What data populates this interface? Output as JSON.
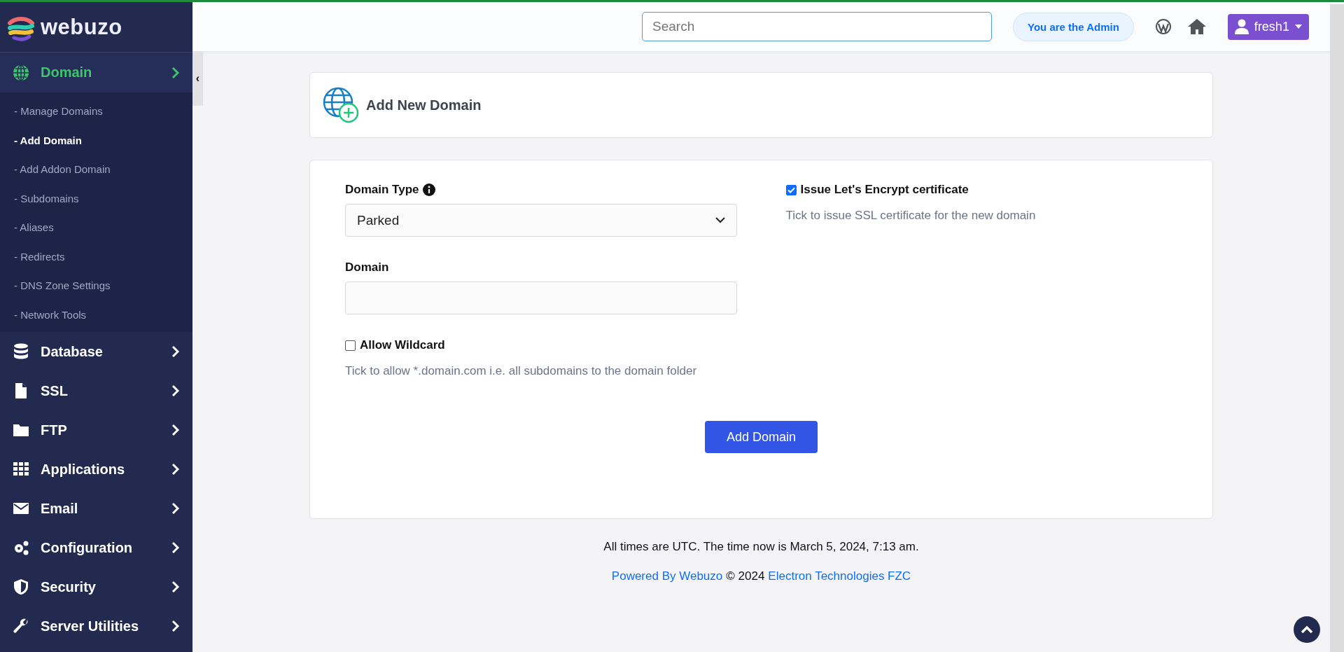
{
  "sidebar": {
    "logo": "webuzo",
    "menu": [
      {
        "label": "Domain",
        "expanded": true,
        "children": [
          {
            "label": "- Manage Domains",
            "selected": false
          },
          {
            "label": "- Add Domain",
            "selected": true
          },
          {
            "label": "- Add Addon Domain",
            "selected": false
          },
          {
            "label": "- Subdomains",
            "selected": false
          },
          {
            "label": "- Aliases",
            "selected": false
          },
          {
            "label": "- Redirects",
            "selected": false
          },
          {
            "label": "- DNS Zone Settings",
            "selected": false
          },
          {
            "label": "- Network Tools",
            "selected": false
          }
        ]
      },
      {
        "label": "Database",
        "expanded": false
      },
      {
        "label": "SSL",
        "expanded": false
      },
      {
        "label": "FTP",
        "expanded": false
      },
      {
        "label": "Applications",
        "expanded": false
      },
      {
        "label": "Email",
        "expanded": false
      },
      {
        "label": "Configuration",
        "expanded": false
      },
      {
        "label": "Security",
        "expanded": false
      },
      {
        "label": "Server Utilities",
        "expanded": false
      }
    ],
    "collapse": "‹"
  },
  "header": {
    "search": {
      "placeholder": "Search"
    },
    "admin_badge": "You are the Admin",
    "user": "fresh1"
  },
  "page_title": "Add New Domain",
  "form": {
    "domain_type": {
      "label": "Domain Type",
      "value": "Parked"
    },
    "domain": {
      "label": "Domain"
    },
    "allow_wildcard": {
      "label": "Allow Wildcard",
      "checked": false,
      "help": "Tick to allow *.domain.com i.e. all subdomains to the domain folder"
    },
    "issue_ssl": {
      "label": "Issue Let's Encrypt certificate",
      "checked": true,
      "help": "Tick to issue SSL certificate for the new domain"
    },
    "submit": "Add Domain"
  },
  "footer": {
    "time": "All times are UTC. The time now is March 5, 2024, 7:13 am.",
    "powered": "Powered By Webuzo",
    "copyright": "© 2024",
    "company": "Electron Technologies FZC"
  }
}
